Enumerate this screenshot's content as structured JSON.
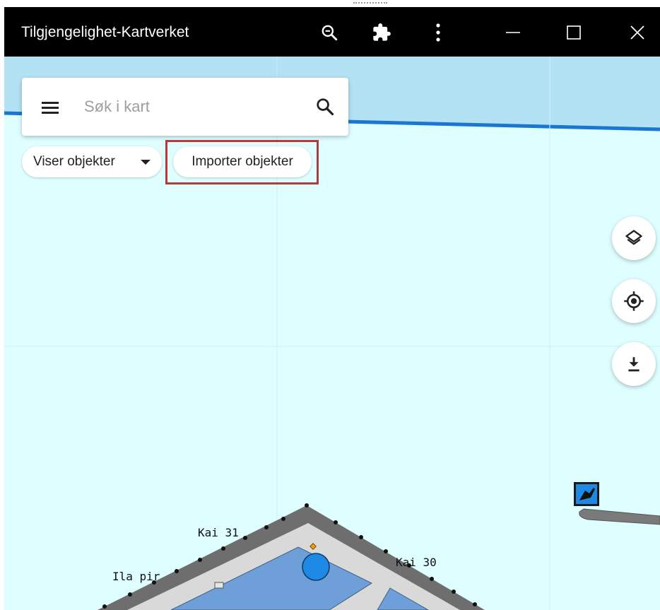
{
  "window": {
    "title": "Tilgjengelighet-Kartverket",
    "controls": [
      "zoom-out-icon",
      "extension-icon",
      "more-vert-icon",
      "minimize-icon",
      "maximize-icon",
      "close-icon"
    ]
  },
  "search": {
    "placeholder": "Søk i kart",
    "value": ""
  },
  "filters": {
    "showing_label": "Viser objekter",
    "import_label": "Importer objekter"
  },
  "map_controls": [
    "layers-icon",
    "my-location-icon",
    "download-icon"
  ],
  "map": {
    "labels": {
      "kai31": "Kai 31",
      "kai30": "Kai 30",
      "ila_pir": "Ila pir"
    }
  },
  "colors": {
    "titlebar": "#000000",
    "map_water": "#dffeff",
    "map_band": "#b3e2f4",
    "accent_blue": "#1976d2",
    "highlight": "#b23b3b",
    "building": "#6f9fd8"
  }
}
